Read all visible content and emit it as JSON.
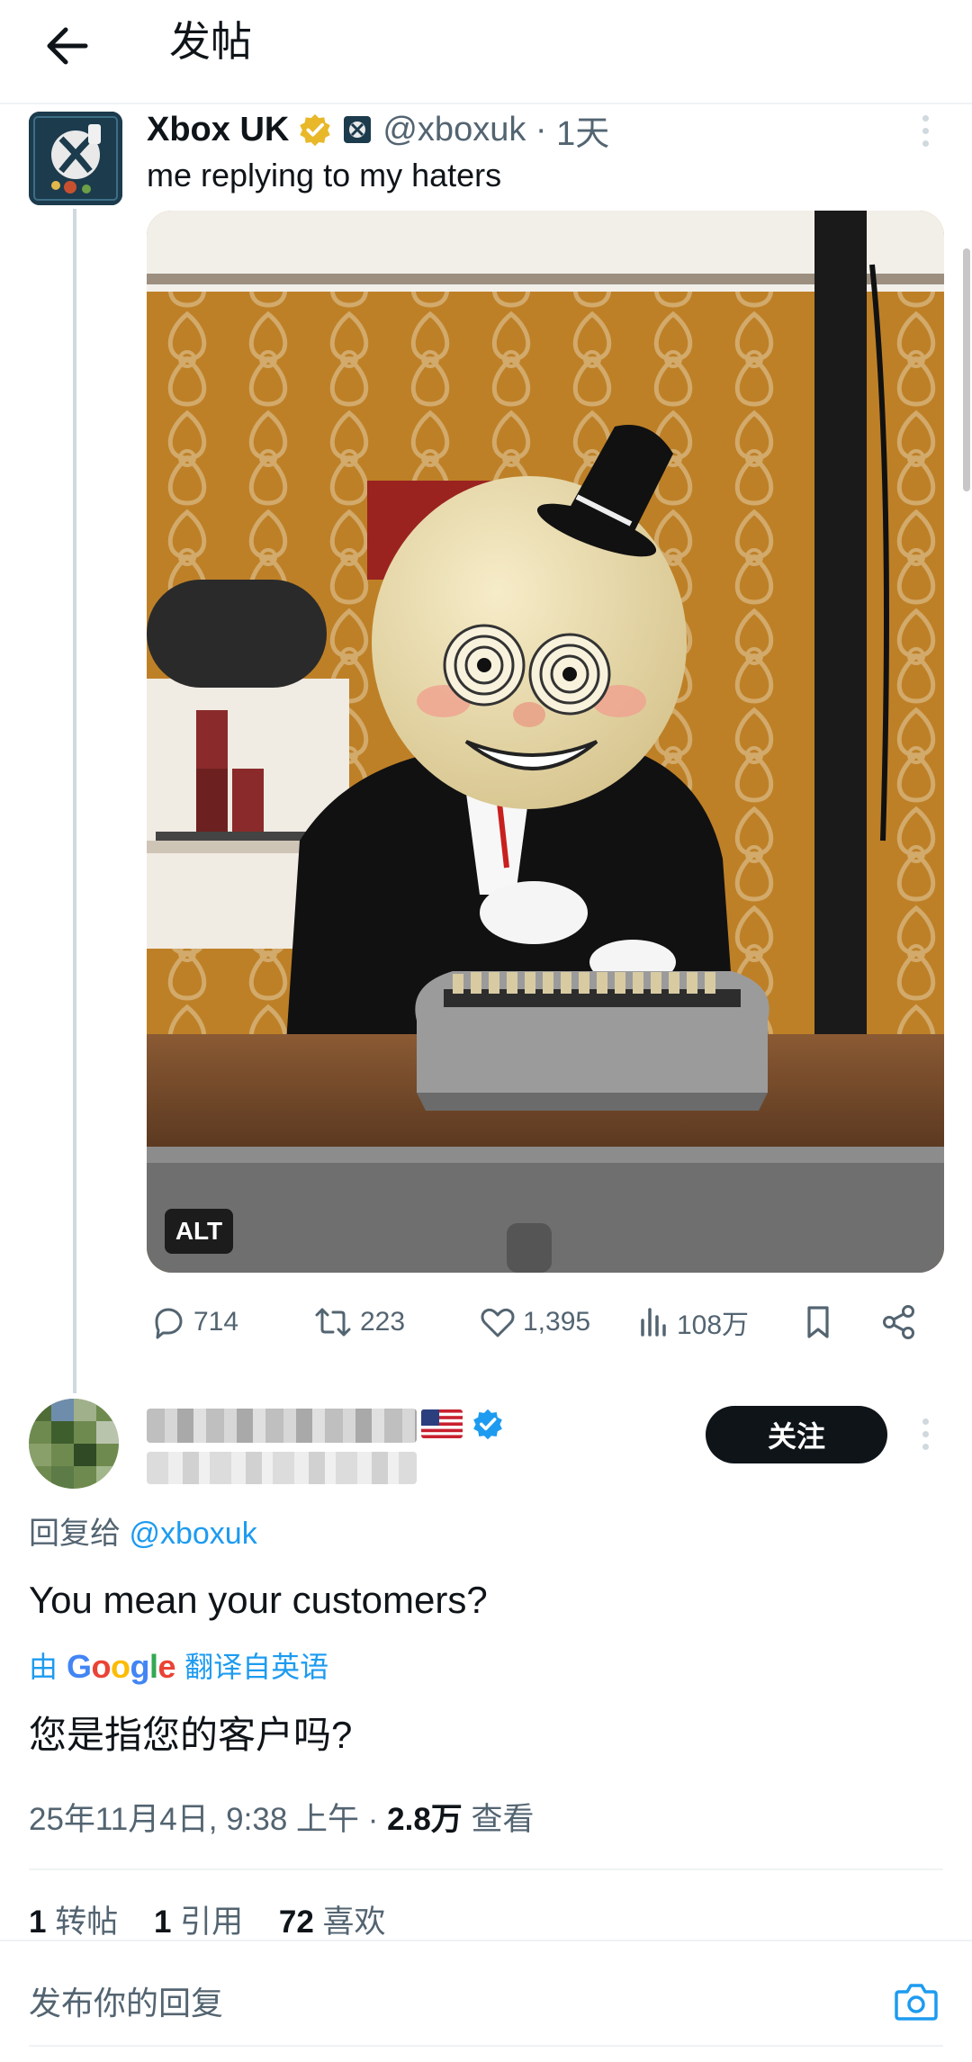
{
  "header": {
    "title": "发帖",
    "back_icon": "arrow-left-icon"
  },
  "original_post": {
    "display_name": "Xbox UK",
    "handle": "@xboxuk",
    "separator": " · ",
    "time": "1天",
    "text": "me replying to my haters",
    "alt_badge": "ALT",
    "actions": {
      "replies": "714",
      "reposts": "223",
      "likes": "1,395",
      "views": "108万"
    },
    "badge_color": "#e8b829"
  },
  "reply": {
    "flag": "🇺🇸",
    "follow_label": "关注",
    "replying_prefix": "回复给 ",
    "replying_handle": "@xboxuk",
    "text": "You mean your customers?",
    "translate_prefix": "由",
    "translate_brand": "Google",
    "translate_suffix": "翻译自英语",
    "translated_text": "您是指您的客户吗?",
    "timestamp": "25年11月4日, 9:38 上午 · ",
    "views_count": "2.8万",
    "views_label": " 查看",
    "stats": {
      "reposts_count": "1",
      "reposts_label": " 转帖",
      "quotes_count": "1",
      "quotes_label": " 引用",
      "likes_count": "72",
      "likes_label": " 喜欢"
    }
  },
  "composer": {
    "placeholder": "发布你的回复"
  },
  "colors": {
    "accent": "#1d9bf0",
    "text": "#0f1419",
    "muted": "#536471"
  }
}
